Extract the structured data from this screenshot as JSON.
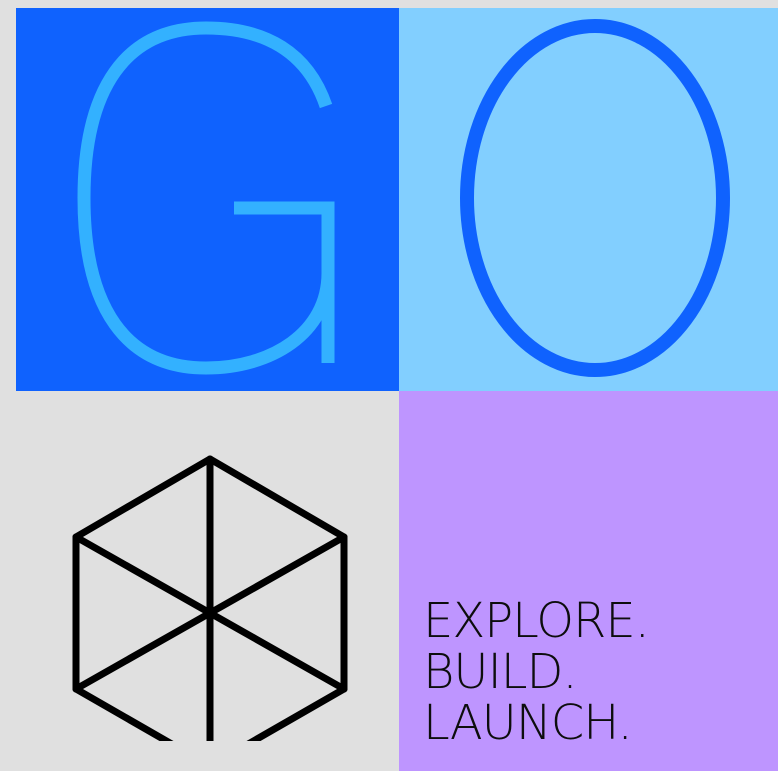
{
  "colors": {
    "background": "#e0e0e0",
    "panel_g": "#0f62fe",
    "letter_g": "#33b1ff",
    "panel_o": "#82cfff",
    "letter_o": "#0f62fe",
    "panel_text": "#be95ff",
    "text": "#0d0d0d",
    "icon_stroke": "#000000"
  },
  "hero": {
    "letter_1": "G",
    "letter_2": "O"
  },
  "icon": {
    "name": "hexagon-cube-icon"
  },
  "tagline": {
    "line_1": "EXPLORE.",
    "line_2": "BUILD.",
    "line_3": "LAUNCH."
  }
}
